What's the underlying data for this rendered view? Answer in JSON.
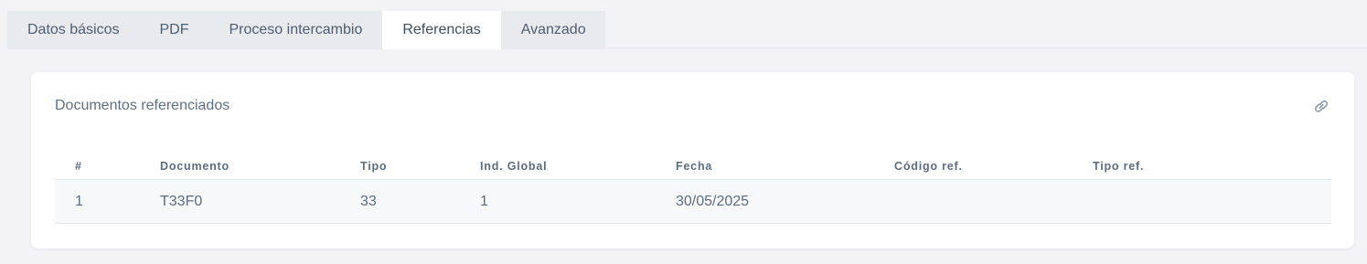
{
  "tabs": [
    {
      "label": "Datos básicos"
    },
    {
      "label": "PDF"
    },
    {
      "label": "Proceso intercambio"
    },
    {
      "label": "Referencias"
    },
    {
      "label": "Avanzado"
    }
  ],
  "active_tab": "Referencias",
  "card": {
    "title": "Documentos referenciados",
    "action_icon": "link-icon"
  },
  "table": {
    "headers": [
      "#",
      "Documento",
      "Tipo",
      "Ind. Global",
      "Fecha",
      "Código ref.",
      "Tipo ref."
    ],
    "rows": [
      [
        "1",
        "T33F0",
        "33",
        "1",
        "30/05/2025",
        "",
        ""
      ]
    ]
  }
}
